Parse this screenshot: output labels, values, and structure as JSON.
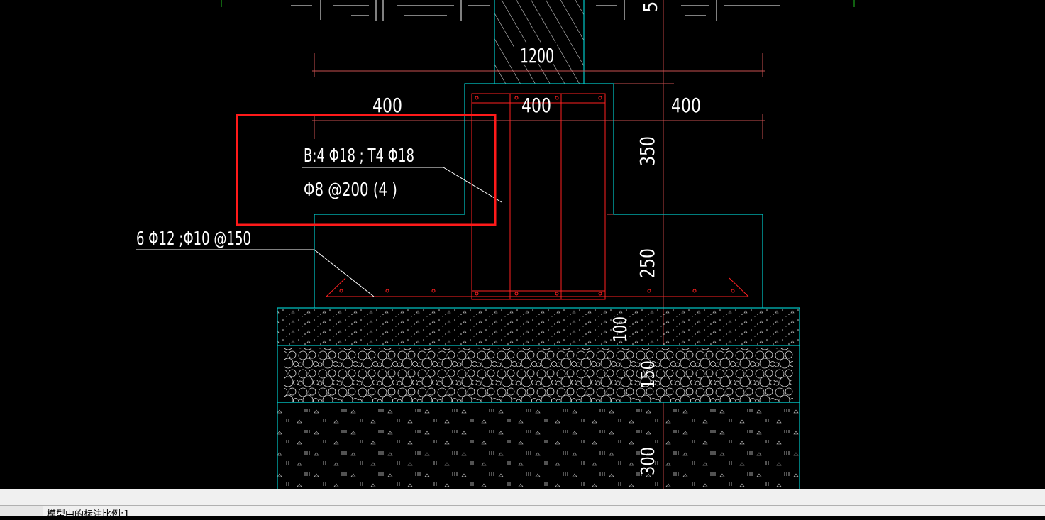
{
  "drawing": {
    "colors": {
      "background": "#000000",
      "outline": "#00c8c8",
      "rebar": "#ff2020",
      "axis": "#b84040",
      "dimension": "#ffffff",
      "highlight": "#ff1a1a"
    },
    "dimensions": {
      "column_width": "1200",
      "left_step": "400",
      "middle_step": "400",
      "right_step": "400",
      "top_height": "350",
      "bottom_height": "250",
      "cushion": "100",
      "gravel": "150",
      "soil": "300",
      "top_cut": "5"
    },
    "annotations": {
      "beam_rebar": "B:4 Φ18 ; T4 Φ18",
      "stirrups": "Φ8 @200 (4 )",
      "slab_rebar": "6 Φ12 ;Φ10 @150"
    }
  },
  "status_bar": {
    "text": "模型中的标注比例:1"
  }
}
